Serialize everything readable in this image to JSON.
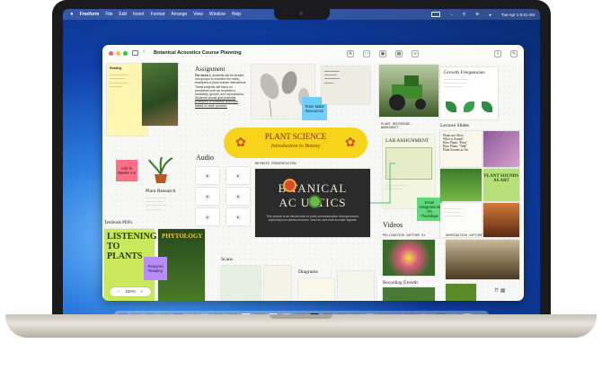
{
  "menubar": {
    "apple": "",
    "app": "Freeform",
    "items": [
      "File",
      "Edit",
      "Insert",
      "Format",
      "Arrange",
      "View",
      "Window",
      "Help"
    ],
    "clock": "Tue Apr 1 9:41 AM"
  },
  "window": {
    "title": "Botanical Acoustics Course Planning"
  },
  "board": {
    "assignment": {
      "heading": "Assignment",
      "body_bold": "For week 1,",
      "body": "students will be divided into groups to examine the many examples of plant-human interactions. These projects will focus on processes such as respiration, sensitivity, growth, and reproduction.",
      "body_link": "Students should give potential examples of botanical acoustics based on each process."
    },
    "note_reading": "Reading",
    "sticky_team": "Team Make Resources",
    "sticky_add": "Add To Weeks 1-6",
    "sticky_required": "Required Reading",
    "sticky_email": "Email Assignments On Thursdays",
    "banner": {
      "title": "PLANT SCIENCE",
      "subtitle": "Introduction to Botany"
    },
    "audio_label": "Audio",
    "keynote_label": "KEYNOTE PRESENTATION",
    "keynote_title_1": "B TANICAL",
    "keynote_title_2": "AC USTICS",
    "keynote_body": "This course is an introduction to plant communication through sound, exploring how plants perceive, react to, and emit acoustic signals.",
    "plant_research_heading": "Plant Research",
    "textbook_label": "Textbook PDFs",
    "book1_title": "LISTENING TO PLANTS",
    "book2_title": "PHYTOLOGY",
    "scans_label": "Scans",
    "diagrams_label": "Diagrams",
    "videos_label": "Videos",
    "pollination_label": "POLLINATION CAPTURE 01",
    "germination_label": "GERMINATION CAPTURE 02",
    "recording_label": "Recording Growth",
    "worksheet_label": "PLANT RECORDING WORKSHEET",
    "lab_title": "LAB ASSIGNMENT",
    "growth_heading": "Growth Frequencies",
    "lecture_heading": "Lecture Slides",
    "lecture_list": [
      "Plants are Alive",
      "What is Sound?",
      "How Plants \"Hear\"",
      "How Plants \"Talk\"",
      "Plant Sounds as Art"
    ],
    "poster_text": "PLANT SOUNDS AS ART",
    "zoom": "100%"
  },
  "colors": {
    "banner": "#f6d41a",
    "sticky_pink": "#ff6f87",
    "sticky_blue": "#6fd0ff",
    "sticky_purple": "#b98bff",
    "sticky_green": "#5fdc7a",
    "keynote_bg": "#2b2b2b"
  },
  "dock_apps": [
    "finder-icon",
    "launchpad-icon",
    "safari-icon",
    "messages-icon",
    "mail-icon",
    "maps-icon",
    "photos-icon",
    "facetime-icon",
    "phone-icon",
    "calendar-icon",
    "contacts-icon",
    "reminders-icon",
    "notes-icon",
    "freeform-icon",
    "tv-icon",
    "music-icon",
    "keynote-icon",
    "numbers-icon",
    "pages-icon",
    "news-icon",
    "app-store-icon",
    "iphone-mirroring-icon",
    "settings-icon",
    "screen-time-icon",
    "downloads-icon",
    "trash-icon"
  ]
}
